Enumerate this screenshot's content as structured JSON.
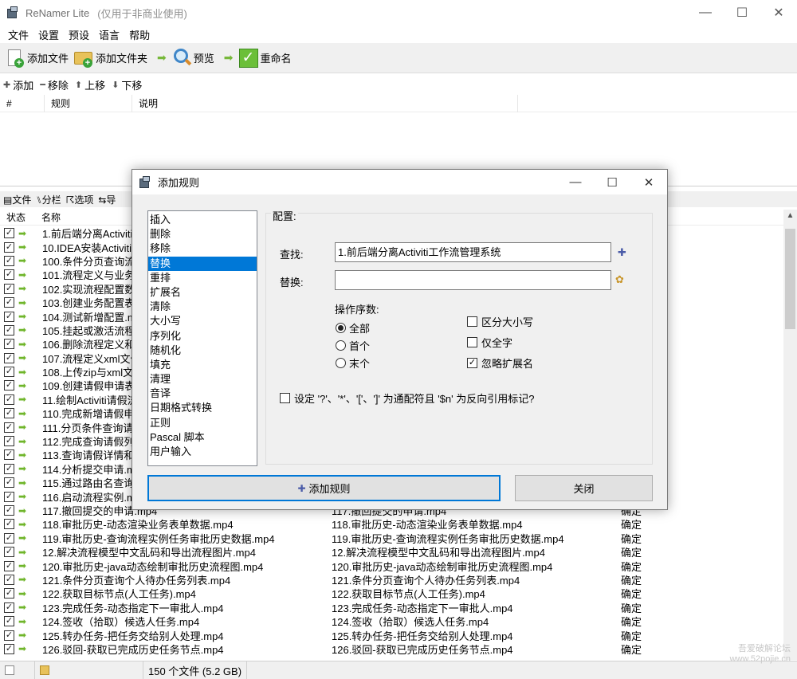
{
  "window": {
    "title": "ReNamer Lite",
    "subtitle": "(仅用于非商业使用)",
    "controls": [
      "—",
      "☐",
      "✕"
    ]
  },
  "menu": [
    "文件",
    "设置",
    "预设",
    "语言",
    "帮助"
  ],
  "toolbar": {
    "add_files": "添加文件",
    "add_folder": "添加文件夹",
    "preview": "预览",
    "rename": "重命名"
  },
  "rules_toolbar": {
    "add": "添加",
    "remove": "移除",
    "up": "上移",
    "down": "下移"
  },
  "rules_table": {
    "columns": [
      "#",
      "规则",
      "说明"
    ]
  },
  "files_toolbar": {
    "files": "文件",
    "columns": "分栏",
    "options": "选项",
    "export": "导"
  },
  "files_table": {
    "columns": {
      "status": "状态",
      "name": "名称"
    },
    "rows": [
      {
        "name": "1.前后端分离Activiti工作流管理系统.mp4",
        "new": "",
        "err": ""
      },
      {
        "name": "10.IDEA安装Activiti插件.mp4",
        "new": "",
        "err": ""
      },
      {
        "name": "100.条件分页查询流程定义.mp4",
        "new": "",
        "err": ""
      },
      {
        "name": "101.流程定义与业务表单.mp4",
        "new": "",
        "err": ""
      },
      {
        "name": "102.实现流程配置数据.mp4",
        "new": "",
        "err": ""
      },
      {
        "name": "103.创建业务配置表单.mp4",
        "new": "",
        "err": ""
      },
      {
        "name": "104.测试新增配置.mp4",
        "new": "",
        "err": ""
      },
      {
        "name": "105.挂起或激活流程.mp4",
        "new": "",
        "err": ""
      },
      {
        "name": "106.删除流程定义和部署.mp4",
        "new": "",
        "err": ""
      },
      {
        "name": "107.流程定义xml文件.mp4",
        "new": "",
        "err": ""
      },
      {
        "name": "108.上传zip与xml文件.mp4",
        "new": "",
        "err": ""
      },
      {
        "name": "109.创建请假申请表.mp4",
        "new": "",
        "err": ""
      },
      {
        "name": "11.绘制Activiti请假流程.mp4",
        "new": "",
        "err": ""
      },
      {
        "name": "110.完成新增请假申请.mp4",
        "new": "",
        "err": ""
      },
      {
        "name": "111.分页条件查询请假.mp4",
        "new": "",
        "err": ""
      },
      {
        "name": "112.完成查询请假列表.mp4",
        "new": "",
        "err": ""
      },
      {
        "name": "113.查询请假详情和编辑.mp4",
        "new": "",
        "err": ""
      },
      {
        "name": "114.分析提交申请.mp4",
        "new": "",
        "err": ""
      },
      {
        "name": "115.通过路由名查询.mp4",
        "new": "",
        "err": ""
      },
      {
        "name": "116.启动流程实例.mp4",
        "new": "",
        "err": ""
      },
      {
        "name": "117.撤回提交的申请.mp4",
        "new": "117.撤回提交的申请.mp4",
        "err": "确定"
      },
      {
        "name": "118.审批历史-动态渲染业务表单数据.mp4",
        "new": "118.审批历史-动态渲染业务表单数据.mp4",
        "err": "确定"
      },
      {
        "name": "119.审批历史-查询流程实例任务审批历史数据.mp4",
        "new": "119.审批历史-查询流程实例任务审批历史数据.mp4",
        "err": "确定"
      },
      {
        "name": "12.解决流程模型中文乱码和导出流程图片.mp4",
        "new": "12.解决流程模型中文乱码和导出流程图片.mp4",
        "err": "确定"
      },
      {
        "name": "120.审批历史-java动态绘制审批历史流程图.mp4",
        "new": "120.审批历史-java动态绘制审批历史流程图.mp4",
        "err": "确定"
      },
      {
        "name": "121.条件分页查询个人待办任务列表.mp4",
        "new": "121.条件分页查询个人待办任务列表.mp4",
        "err": "确定"
      },
      {
        "name": "122.获取目标节点(人工任务).mp4",
        "new": "122.获取目标节点(人工任务).mp4",
        "err": "确定"
      },
      {
        "name": "123.完成任务-动态指定下一审批人.mp4",
        "new": "123.完成任务-动态指定下一审批人.mp4",
        "err": "确定"
      },
      {
        "name": "124.签收（拾取）候选人任务.mp4",
        "new": "124.签收（拾取）候选人任务.mp4",
        "err": "确定"
      },
      {
        "name": "125.转办任务-把任务交给别人处理.mp4",
        "new": "125.转办任务-把任务交给别人处理.mp4",
        "err": "确定"
      },
      {
        "name": "126.驳回-获取已完成历史任务节点.mp4",
        "new": "126.驳回-获取已完成历史任务节点.mp4",
        "err": "确定"
      }
    ]
  },
  "statusbar": {
    "file_count": "150 个文件 (5.2 GB)"
  },
  "watermark": {
    "line1": "吾爱破解论坛",
    "line2": "www.52pojie.cn"
  },
  "dialog": {
    "title": "添加规则",
    "controls": [
      "—",
      "☐",
      "✕"
    ],
    "rule_types": [
      "插入",
      "删除",
      "移除",
      "替换",
      "重排",
      "扩展名",
      "清除",
      "大小写",
      "序列化",
      "随机化",
      "填充",
      "清理",
      "音译",
      "日期格式转换",
      "正则",
      "Pascal 脚本",
      "用户输入"
    ],
    "selected_rule": "替换",
    "config_label": "配置:",
    "find_label": "查找:",
    "find_value": "1.前后端分离Activiti工作流管理系统",
    "replace_label": "替换:",
    "replace_value": "",
    "occurrence_label": "操作序数:",
    "occurrence_options": [
      "全部",
      "首个",
      "末个"
    ],
    "occurrence_selected": "全部",
    "case_sensitive": "区分大小写",
    "whole_word": "仅全字",
    "ignore_ext": "忽略扩展名",
    "case_sensitive_checked": false,
    "whole_word_checked": false,
    "ignore_ext_checked": true,
    "wildcard_option": "设定 '?'、'*'、'['、']' 为通配符且 '$n' 为反向引用标记?",
    "wildcard_checked": false,
    "add_button": "添加规则",
    "close_button": "关闭"
  }
}
